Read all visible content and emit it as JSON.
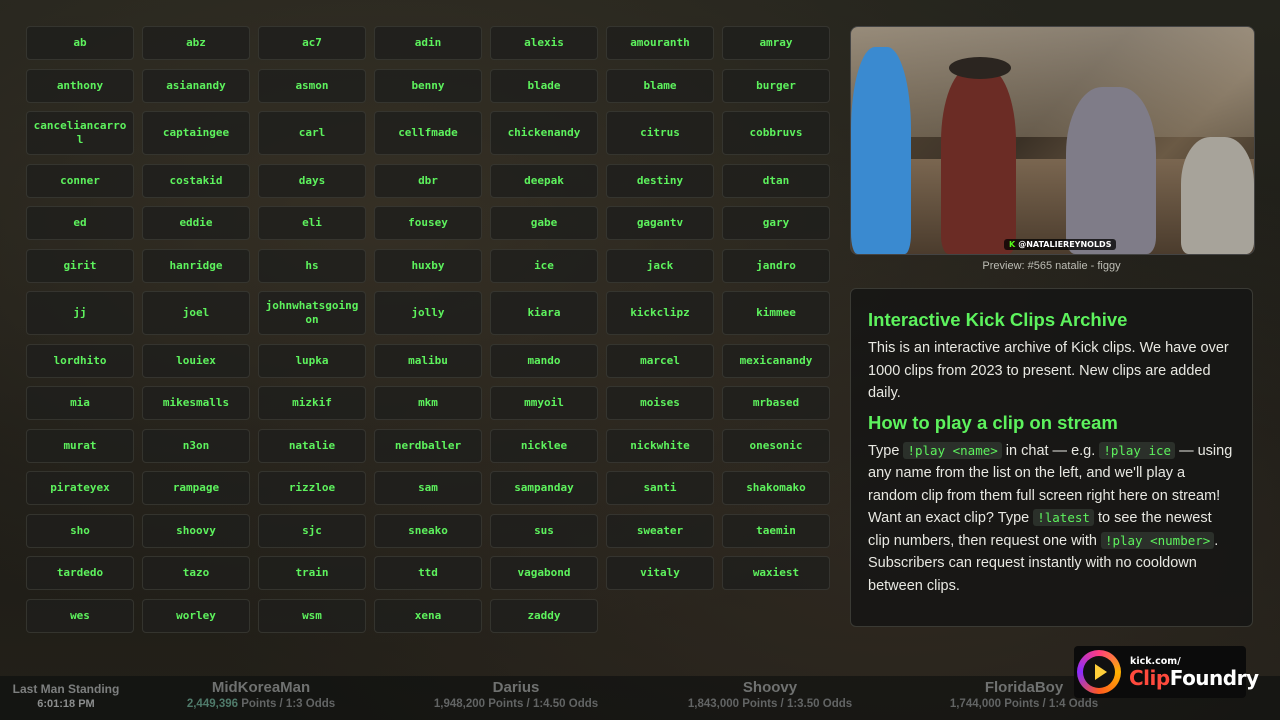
{
  "names": [
    "ab",
    "abz",
    "ac7",
    "adin",
    "alexis",
    "amouranth",
    "amray",
    "anthony",
    "asianandy",
    "asmon",
    "benny",
    "blade",
    "blame",
    "burger",
    "canceliancarrol",
    "captaingee",
    "carl",
    "cellfmade",
    "chickenandy",
    "citrus",
    "cobbruvs",
    "conner",
    "costakid",
    "days",
    "dbr",
    "deepak",
    "destiny",
    "dtan",
    "ed",
    "eddie",
    "eli",
    "fousey",
    "gabe",
    "gagantv",
    "gary",
    "girit",
    "hanridge",
    "hs",
    "huxby",
    "ice",
    "jack",
    "jandro",
    "jj",
    "joel",
    "johnwhatsgoingon",
    "jolly",
    "kiara",
    "kickclipz",
    "kimmee",
    "lordhito",
    "louiex",
    "lupka",
    "malibu",
    "mando",
    "marcel",
    "mexicanandy",
    "mia",
    "mikesmalls",
    "mizkif",
    "mkm",
    "mmyoil",
    "moises",
    "mrbased",
    "murat",
    "n3on",
    "natalie",
    "nerdballer",
    "nicklee",
    "nickwhite",
    "onesonic",
    "pirateyex",
    "rampage",
    "rizzloe",
    "sam",
    "sampanday",
    "santi",
    "shakomako",
    "sho",
    "shoovy",
    "sjc",
    "sneako",
    "sus",
    "sweater",
    "taemin",
    "tardedo",
    "tazo",
    "train",
    "ttd",
    "vagabond",
    "vitaly",
    "waxiest",
    "wes",
    "worley",
    "wsm",
    "xena",
    "zaddy"
  ],
  "preview": {
    "caption": "Preview: #565 natalie - figgy",
    "watermark_k": "K",
    "watermark": "@NATALIEREYNOLDS"
  },
  "info": {
    "title": "Interactive Kick Clips Archive",
    "intro": "This is an interactive archive of Kick clips. We have over 1000 clips from 2023 to present. New clips are added daily.",
    "howto_title": "How to play a clip on stream",
    "t1": "Type ",
    "c1": "!play <name>",
    "t2": " in chat — e.g. ",
    "c2": "!play ice",
    "t3": " — using any name from the list on the left, and we'll play a random clip from them full screen right here on stream! Want an exact clip? Type ",
    "c3": "!latest",
    "t4": " to see the newest clip numbers, then request one with ",
    "c4": "!play <number>",
    "t5": ". Subscribers can request instantly with no cooldown between clips."
  },
  "ticker": {
    "label": "Last Man Standing",
    "time": "6:01:18 PM",
    "entries": [
      {
        "name": "MidKoreaMan",
        "points": "2,449,396",
        "rest": " Points / 1:3 Odds"
      },
      {
        "name": "Darius",
        "points": "",
        "rest": "1,948,200 Points / 1:4.50 Odds"
      },
      {
        "name": "Shoovy",
        "points": "",
        "rest": "1,843,000 Points / 1:3.50 Odds"
      },
      {
        "name": "FloridaBoy",
        "points": "",
        "rest": "1,744,000 Points / 1:4 Odds"
      }
    ]
  },
  "logo": {
    "small": "kick.com/",
    "word1": "Clip",
    "word2": "Foundry"
  },
  "colors": {
    "accent": "#5df25d",
    "kick_green": "#53fc18"
  }
}
